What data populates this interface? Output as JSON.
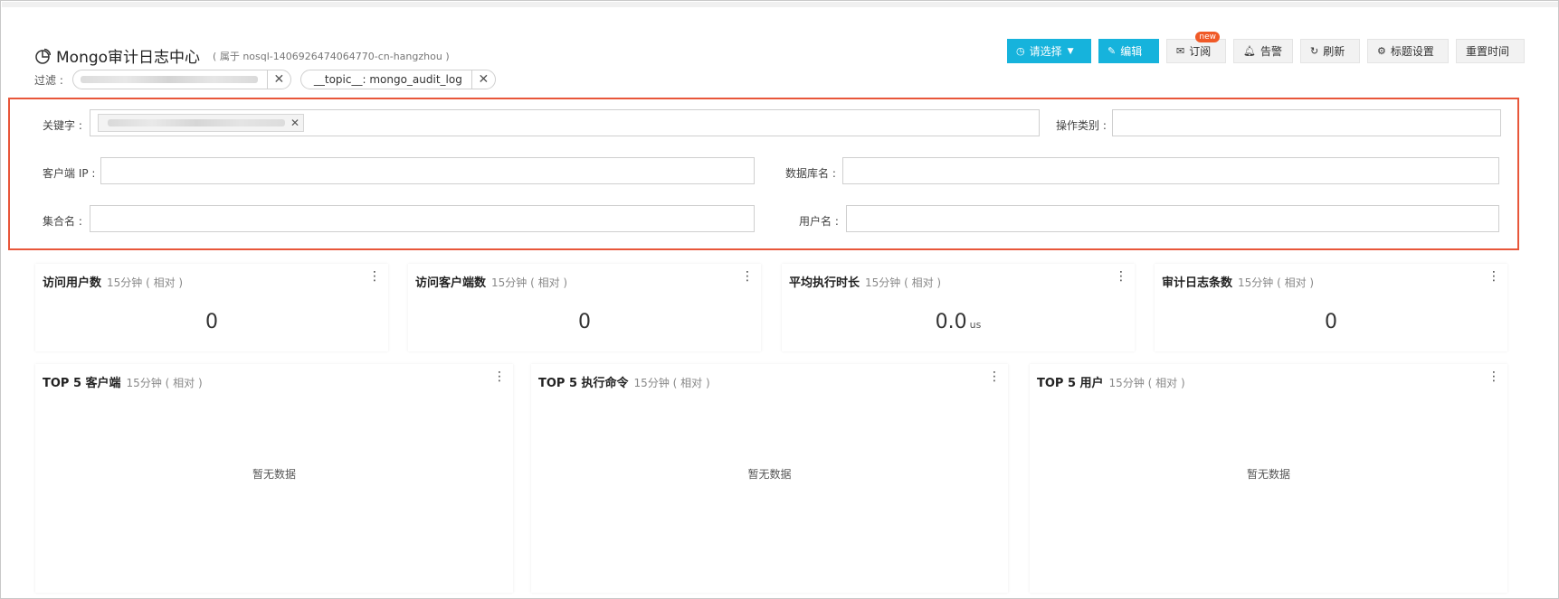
{
  "header": {
    "title": "Mongo审计日志中心",
    "subtitle": "( 属于 nosql-1406926474064770-cn-hangzhou )",
    "filter_label": "过滤 :",
    "filters": [
      {
        "text": ""
      },
      {
        "text": "__topic__: mongo_audit_log"
      }
    ]
  },
  "toolbar": {
    "select_label": "请选择",
    "edit_label": "编辑",
    "subscribe_label": "订阅",
    "subscribe_badge": "new",
    "alert_label": "告警",
    "refresh_label": "刷新",
    "title_settings_label": "标题设置",
    "reset_time_label": "重置时间"
  },
  "search": {
    "keyword_label": "关键字 :",
    "op_type_label": "操作类别 :",
    "client_ip_label": "客户端 IP :",
    "db_name_label": "数据库名 :",
    "collection_label": "集合名 :",
    "user_label": "用户名 :"
  },
  "metrics": [
    {
      "title": "访问用户数",
      "range": "15分钟 ( 相对 )",
      "value": "0",
      "unit": ""
    },
    {
      "title": "访问客户端数",
      "range": "15分钟 ( 相对 )",
      "value": "0",
      "unit": ""
    },
    {
      "title": "平均执行时长",
      "range": "15分钟 ( 相对 )",
      "value": "0.0",
      "unit": "us"
    },
    {
      "title": "审计日志条数",
      "range": "15分钟 ( 相对 )",
      "value": "0",
      "unit": ""
    }
  ],
  "top_charts": [
    {
      "title": "TOP 5 客户端",
      "range": "15分钟 ( 相对 )",
      "empty": "暂无数据"
    },
    {
      "title": "TOP 5 执行命令",
      "range": "15分钟 ( 相对 )",
      "empty": "暂无数据"
    },
    {
      "title": "TOP 5 用户",
      "range": "15分钟 ( 相对 )",
      "empty": "暂无数据"
    }
  ],
  "colors": {
    "primary": "#16b3dc",
    "highlight_border": "#e8563a",
    "badge": "#f05a28"
  }
}
